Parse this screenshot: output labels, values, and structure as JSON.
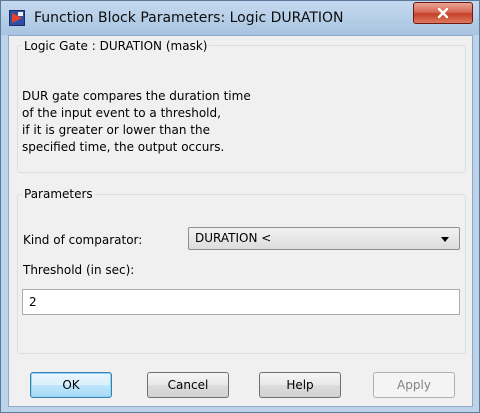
{
  "window": {
    "title": "Function Block Parameters: Logic DURATION",
    "close_symbol": "x",
    "icon": "simulink-block-icon"
  },
  "mask_group": {
    "legend": "Logic Gate : DURATION (mask)",
    "description_lines": [
      "DUR gate compares the duration time",
      "of the input event to a threshold,",
      "if it is greater or lower than the",
      "specified time, the output occurs."
    ]
  },
  "parameters_group": {
    "legend": "Parameters",
    "comparator_label": "Kind of comparator:",
    "comparator_value": "DURATION <",
    "threshold_label": "Threshold (in sec):",
    "threshold_value": "2"
  },
  "buttons": {
    "ok": "OK",
    "cancel": "Cancel",
    "help": "Help",
    "apply": "Apply"
  },
  "colors": {
    "title_bar": "#b9d1ea",
    "close_button": "#c7402a",
    "client_bg": "#f0f0f0",
    "default_button": "#bee6fd"
  }
}
